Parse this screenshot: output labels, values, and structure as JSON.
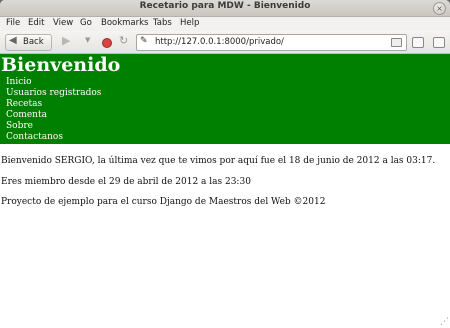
{
  "window": {
    "title": "Recetario para MDW - Bienvenido",
    "close_glyph": "×"
  },
  "menu": {
    "items": [
      "File",
      "Edit",
      "View",
      "Go",
      "Bookmarks",
      "Tabs",
      "Help"
    ]
  },
  "toolbar": {
    "back_label": "Back",
    "back_icon": "back-arrow-icon",
    "forward_icon": "forward-arrow-icon",
    "stop_icon": "stop-icon",
    "reload_icon": "reload-icon",
    "site_icon": "site-identity-icon",
    "url": "http://127.0.0.1:8000/privado/"
  },
  "page": {
    "title": "Bienvenido",
    "nav": [
      "Inicio",
      "Usuarios registrados",
      "Recetas",
      "Comenta",
      "Sobre",
      "Contactanos"
    ],
    "paragraphs": [
      "Bienvenido SERGIO, la última vez que te vimos por aquí fue el 18 de junio de 2012 a las 03:17.",
      "Eres miembro desde el 29 de abril de 2012 a las 23:30",
      "Proyecto de ejemplo para el curso Django de Maestros del Web ©2012"
    ]
  },
  "colors": {
    "header_bg": "#008000",
    "header_text": "#ffffff"
  }
}
